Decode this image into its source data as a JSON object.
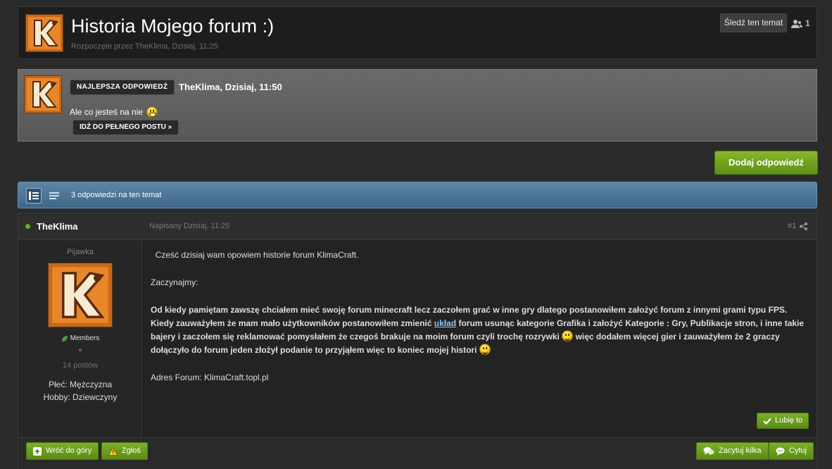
{
  "topic": {
    "title": "Historia Mojego forum :)",
    "meta": "Rozpoczęte przez TheKlima, Dzisiaj, 11:25",
    "follow_label": "Śledź ten temat",
    "followers_count": "1"
  },
  "best_answer": {
    "badge": "NAJLEPSZA ODPOWIEDŹ",
    "author_date": "TheKlima, Dzisiaj, 11:50",
    "text": "Ale co jesteś na nie",
    "goto_label": "IDŹ DO PEŁNEGO POSTU »"
  },
  "reply_label": "Dodaj odpowiedź",
  "replies_bar": {
    "count_text": "3 odpowiedzi na ten temat"
  },
  "post": {
    "author": "TheKlima",
    "date": "Napisany Dzisiaj, 11:25",
    "number": "#1",
    "author_title": "Pijawka",
    "group": "Members",
    "posts_count": "14 postów",
    "field_gender": "Płeć: Mężczyzna",
    "field_hobby": "Hobby: Dziewczyny",
    "body": {
      "p1": "Cześć dzisiaj wam opowiem historie forum KlimaCraft.",
      "p2": "Zaczynajmy:",
      "p3a": "Od kiedy pamiętam zawszę chciałem mieć swoję forum minecraft lecz zaczołem grać w inne gry dlatego postanowiłem założyć forum z innymi grami typu FPS. Kiedy zauważyłem że mam mało użytkowników postanowiłem zmienić ",
      "p3link": "układ",
      "p3b": " forum usunąc kategorie Grafika i założyć Kategorie : Gry, Publikacje stron, i inne takie bajery i zaczołem się reklamować pomysłałem że czegoś brakuje na moim forum czyli trochę rozrywki ",
      "p3c": " więc dodałem więcej gier i zauważyłem że 2 graczy dołączyło do forum jeden złożył podanie to przyjąłem więc to koniec mojej histori ",
      "p4": "Adres Forum: KlimaCraft.topl.pl"
    },
    "like_label": "Lubię to"
  },
  "footer": {
    "back_top": "Wróć do góry",
    "report": "Zgłoś",
    "multiquote": "Zacytuj kilka",
    "quote": "Cytuj"
  },
  "colors": {
    "accent_green": "#6fa21f",
    "bar_blue": "#4d7699",
    "avatar_orange": "#e8862a"
  }
}
